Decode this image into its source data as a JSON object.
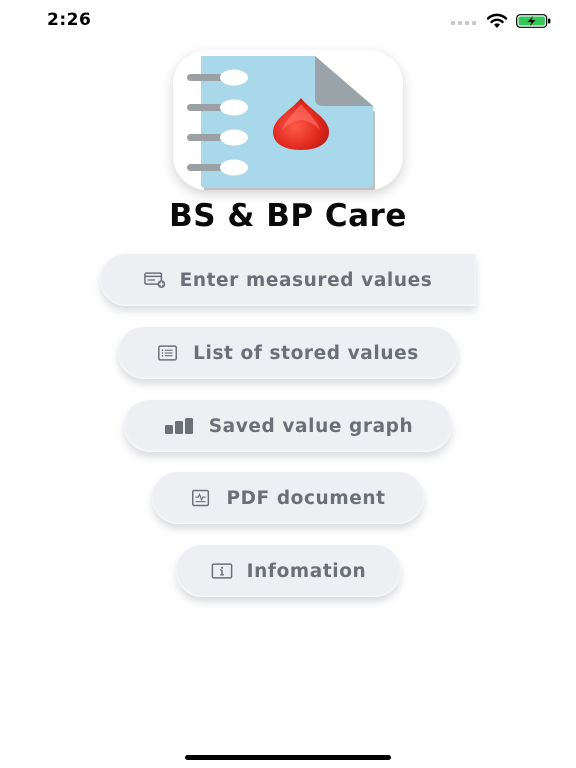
{
  "status_bar": {
    "time": "2:26"
  },
  "app": {
    "title": "BS & BP Care",
    "icon": "notebook-blood-drop-icon"
  },
  "menu": {
    "items": [
      {
        "label": "Enter measured values",
        "icon": "card-add-icon"
      },
      {
        "label": "List of stored values",
        "icon": "list-icon"
      },
      {
        "label": "Saved value graph",
        "icon": "bar-graph-icon"
      },
      {
        "label": "PDF document",
        "icon": "document-icon"
      },
      {
        "label": "Infomation",
        "icon": "info-icon"
      }
    ]
  },
  "colors": {
    "button_bg": "#eeeff2",
    "button_text": "#6b6f78",
    "notebook_blue": "#a8d8ea",
    "drop_red": "#e0291f"
  }
}
